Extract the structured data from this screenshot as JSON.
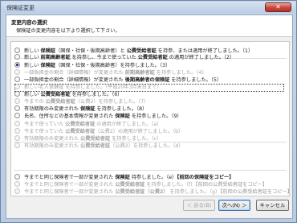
{
  "window": {
    "title": "保険証変更",
    "close_glyph": "✕"
  },
  "header": {
    "title": "変更内容の選択",
    "description": "保険証の変更内容を以下より選択して下さい。"
  },
  "options": [
    {
      "parts": [
        "新しい ",
        "保険証",
        "（国保・社保・後期高齢者）と ",
        "公費受給者証",
        " を持参、または適用が終了しました。（1）"
      ],
      "bold": [
        1,
        3
      ],
      "checked": false,
      "disabled": false
    },
    {
      "parts": [
        "新しい ",
        "前期高齢者証",
        " を持参し、今まで使っていた ",
        "公費受給者証",
        " の適用が終了しました。（2）"
      ],
      "bold": [
        1,
        3
      ],
      "checked": false,
      "disabled": false
    },
    {
      "parts": [
        "新しい ",
        "保険証",
        "（国保・社保・後期高齢者）を持参しました。（3）"
      ],
      "bold": [
        1
      ],
      "checked": true,
      "disabled": false
    },
    {
      "parts": [
        "一部負担金の割合（詳細情報）が変更された ",
        "前期高齢者証",
        " を持参しました。（4）"
      ],
      "bold": [
        1
      ],
      "checked": false,
      "disabled": true
    },
    {
      "parts": [
        "一部負担金の割合（詳細情報）が変更された ",
        "後期高齢者の保険証",
        " を持参しました。（5）"
      ],
      "bold": [
        1
      ],
      "checked": false,
      "disabled": false
    },
    {
      "parts": [
        "新しい老人保健証",
        " を持参しました。（平成20年3月末日まで）"
      ],
      "bold": [],
      "checked": false,
      "disabled": true
    },
    {
      "parts": [
        "新しい ",
        "公費受給者証",
        " を持参しました。（6）"
      ],
      "bold": [
        1
      ],
      "checked": false,
      "disabled": false
    },
    {
      "parts": [
        "今までの ",
        "公費受給者証",
        "（公費2）を持参しました。（7）"
      ],
      "bold": [
        1
      ],
      "checked": false,
      "disabled": true
    },
    {
      "parts": [
        "有効期限のみ変更された ",
        "保険証",
        " を持参しました。（8）"
      ],
      "bold": [
        1
      ],
      "checked": false,
      "disabled": false
    },
    {
      "parts": [
        "氏名、住所などの基本情報が変更された ",
        "保険証",
        " を持参しました。（9）"
      ],
      "bold": [
        1
      ],
      "checked": false,
      "disabled": false
    },
    {
      "parts": [
        "今まで使っていた ",
        "公費受給者証",
        " の適用が終了しました。（a）"
      ],
      "bold": [
        1
      ],
      "checked": false,
      "disabled": true
    },
    {
      "parts": [
        "今まで使っていた ",
        "公費受給者証",
        "（公費2）の適用が終了しました。（b）"
      ],
      "bold": [
        1
      ],
      "checked": false,
      "disabled": true
    },
    {
      "parts": [
        "有効期限のみ変更された ",
        "公費受給者証",
        " を持参しました。（c）"
      ],
      "bold": [
        1
      ],
      "checked": false,
      "disabled": true
    },
    {
      "parts": [
        "有効期限のみ変更された ",
        "公費受給者証",
        "（公費2）を持参しました。（d）"
      ],
      "bold": [
        1
      ],
      "checked": false,
      "disabled": true
    },
    {
      "parts": [
        "今までと同じ保険者で一部が変更された ",
        "保険証",
        " 持参しました。（e）",
        "【前回の保険証をコピー】"
      ],
      "bold": [
        1,
        3
      ],
      "checked": false,
      "disabled": false
    },
    {
      "parts": [
        "今までと同じ保険者で一部が変更された ",
        "公費受給者証",
        " を持参しました。（f）",
        "【前回の公費受給者証をコピー】"
      ],
      "bold": [
        1
      ],
      "checked": false,
      "disabled": true
    },
    {
      "parts": [
        "今までと同じ保険者で一部が変更された ",
        "公費受給者証（公費2）",
        " を持参しました。（g）",
        "【前回の公費受給者証をコピー】"
      ],
      "bold": [
        1
      ],
      "checked": false,
      "disabled": true
    }
  ],
  "buttons": {
    "back": "＜ 戻る(B)",
    "next": "次へ(N) ＞",
    "cancel": "キャンセル"
  }
}
